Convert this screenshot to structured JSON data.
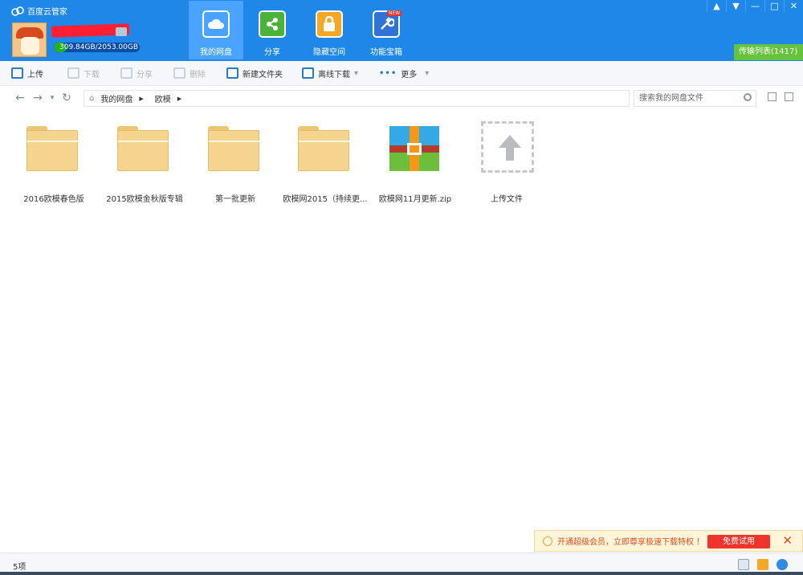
{
  "app": {
    "title": "百度云管家",
    "logo_icon": "cloud-logo-icon"
  },
  "user": {
    "quota_text": "309.84GB/2053.00GB",
    "quota_used_fraction": 0.151
  },
  "nav": {
    "tabs": [
      {
        "label": "我的网盘",
        "icon": "cloud-drive-icon",
        "active": true,
        "color": "#4aa4ff"
      },
      {
        "label": "分享",
        "icon": "share-icon",
        "active": false,
        "color": "#4cb33a"
      },
      {
        "label": "隐藏空间",
        "icon": "lock-icon",
        "active": false,
        "color": "#f5a623"
      },
      {
        "label": "功能宝箱",
        "icon": "toolbox-icon",
        "active": false,
        "color": "#2f73d7",
        "badge": "NEW"
      }
    ]
  },
  "window_controls": [
    "▲",
    "▼",
    "—",
    "□",
    "✕"
  ],
  "transfer_list": {
    "label": "传输列表(1417)"
  },
  "toolbar": {
    "upload": "上传",
    "download": "下载",
    "share": "分享",
    "delete": "删除",
    "new_folder": "新建文件夹",
    "offline_download": "离线下载",
    "more": "更多"
  },
  "address": {
    "breadcrumb": [
      "我的网盘",
      "欧模"
    ],
    "search_placeholder": "搜索我的网盘文件"
  },
  "files": [
    {
      "name": "2016欧模春色版",
      "type": "folder"
    },
    {
      "name": "2015欧模金秋版专辑",
      "type": "folder"
    },
    {
      "name": "第一批更新",
      "type": "folder"
    },
    {
      "name": "欧模网2015（持续更...",
      "type": "folder"
    },
    {
      "name": "欧模网11月更新.zip",
      "type": "zip"
    },
    {
      "name": "上传文件",
      "type": "upload"
    }
  ],
  "promo": {
    "text": "开通超级会员，立即尊享极速下载特权 ！",
    "button": "免费试用",
    "close": "✕"
  },
  "status": {
    "count": "5项"
  }
}
